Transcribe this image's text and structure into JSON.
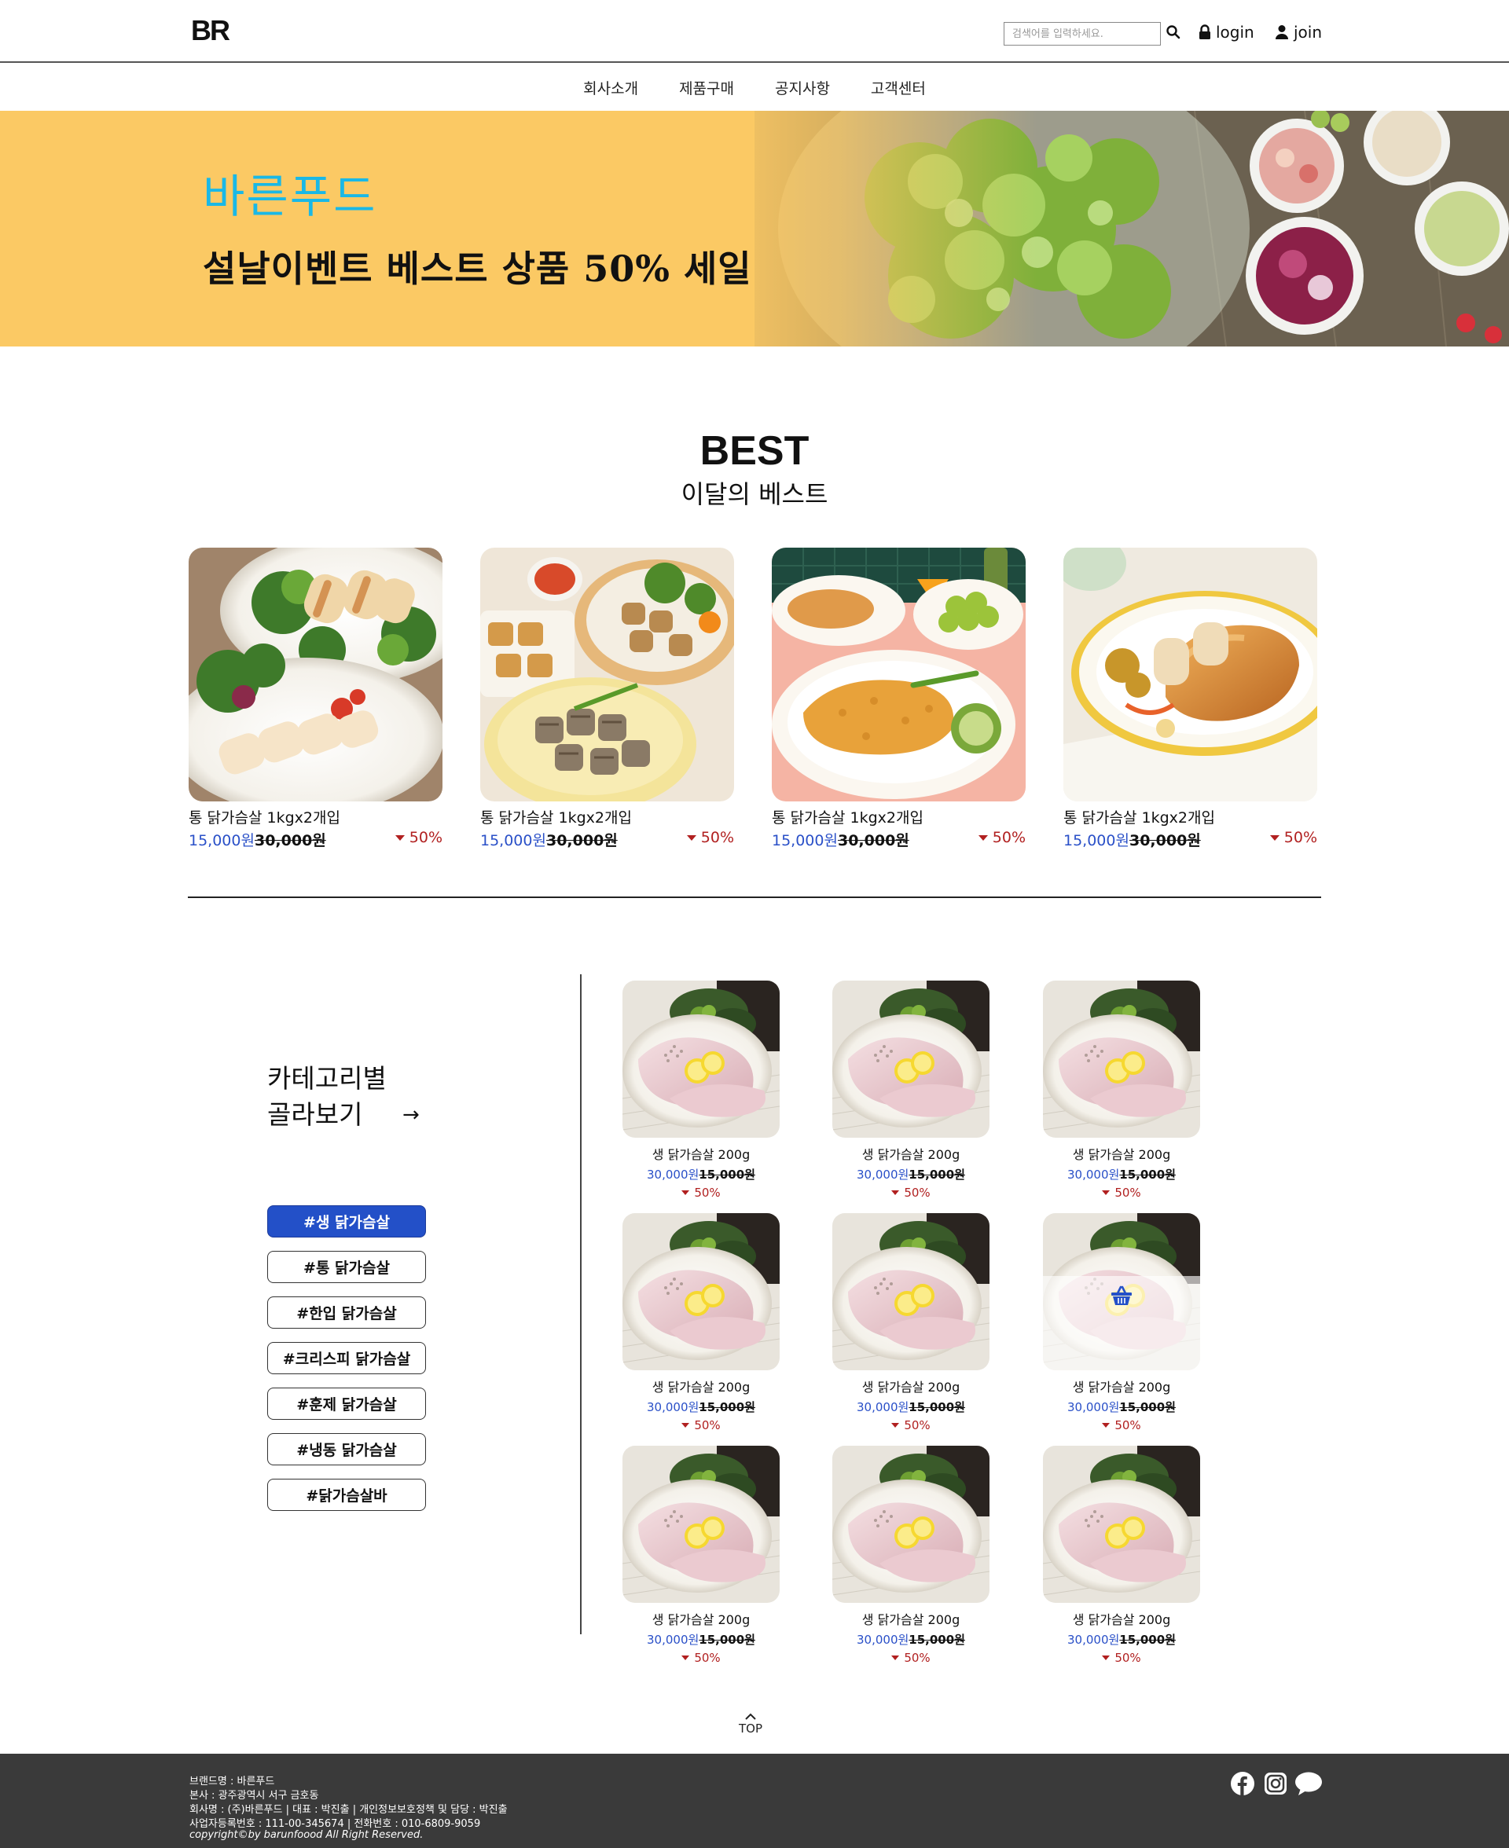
{
  "header": {
    "logo": "BR",
    "search_placeholder": "검색어를 입력하세요.",
    "login_label": "login",
    "join_label": "join"
  },
  "nav": {
    "items": [
      "회사소개",
      "제품구매",
      "공지사항",
      "고객센터"
    ]
  },
  "banner": {
    "brand": "바른푸드",
    "headline": "설날이벤트 베스트 상품 50% 세일"
  },
  "best": {
    "title": "BEST",
    "subtitle": "이달의 베스트",
    "items": [
      {
        "name": "통 닭가슴살 1kgx2개입",
        "price": "15,000원",
        "original_price": "30,000원",
        "discount": "50%"
      },
      {
        "name": "통 닭가슴살 1kgx2개입",
        "price": "15,000원",
        "original_price": "30,000원",
        "discount": "50%"
      },
      {
        "name": "통 닭가슴살 1kgx2개입",
        "price": "15,000원",
        "original_price": "30,000원",
        "discount": "50%"
      },
      {
        "name": "통 닭가슴살 1kgx2개입",
        "price": "15,000원",
        "original_price": "30,000원",
        "discount": "50%"
      }
    ]
  },
  "category": {
    "heading_line1": "카테고리별",
    "heading_line2": "골라보기",
    "arrow": "→",
    "tags": [
      "#생 닭가슴살",
      "#통 닭가슴살",
      "#한입 닭가슴살",
      "#크리스피 닭가슴살",
      "#훈제 닭가슴살",
      "#냉동 닭가슴살",
      "#닭가슴살바"
    ],
    "active_tag": "#생 닭가슴살",
    "products": [
      {
        "name": "생 닭가슴살 200g",
        "price": "30,000원",
        "original_price": "15,000원",
        "discount": "50%"
      },
      {
        "name": "생 닭가슴살 200g",
        "price": "30,000원",
        "original_price": "15,000원",
        "discount": "50%"
      },
      {
        "name": "생 닭가슴살 200g",
        "price": "30,000원",
        "original_price": "15,000원",
        "discount": "50%"
      },
      {
        "name": "생 닭가슴살 200g",
        "price": "30,000원",
        "original_price": "15,000원",
        "discount": "50%"
      },
      {
        "name": "생 닭가슴살 200g",
        "price": "30,000원",
        "original_price": "15,000원",
        "discount": "50%"
      },
      {
        "name": "생 닭가슴살 200g",
        "price": "30,000원",
        "original_price": "15,000원",
        "discount": "50%"
      },
      {
        "name": "생 닭가슴살 200g",
        "price": "30,000원",
        "original_price": "15,000원",
        "discount": "50%"
      },
      {
        "name": "생 닭가슴살 200g",
        "price": "30,000원",
        "original_price": "15,000원",
        "discount": "50%"
      },
      {
        "name": "생 닭가슴살 200g",
        "price": "30,000원",
        "original_price": "15,000원",
        "discount": "50%"
      }
    ]
  },
  "top_button": "TOP",
  "footer": {
    "lines": [
      "브랜드명 : 바른푸드",
      "본사 : 광주광역시 서구 금호동",
      "회사명 : (주)바른푸드 | 대표 : 박진출 | 개인정보보호정책 및 담당 : 박진출",
      "사업자등록번호 : 111-00-345674 | 전화번호 : 010-6809-9059"
    ],
    "copyright": "copyright©by barunfoood All Right Reserved.",
    "icons": [
      "facebook-icon",
      "instagram-icon",
      "chat-bubble-icon"
    ]
  },
  "colors": {
    "accent_blue": "#2350c8",
    "price_blue": "#2a50c8",
    "discount_red": "#b12020",
    "banner_bg": "#fbc964",
    "banner_brand": "#1ab8e6",
    "footer_bg": "#3a3a3a"
  }
}
